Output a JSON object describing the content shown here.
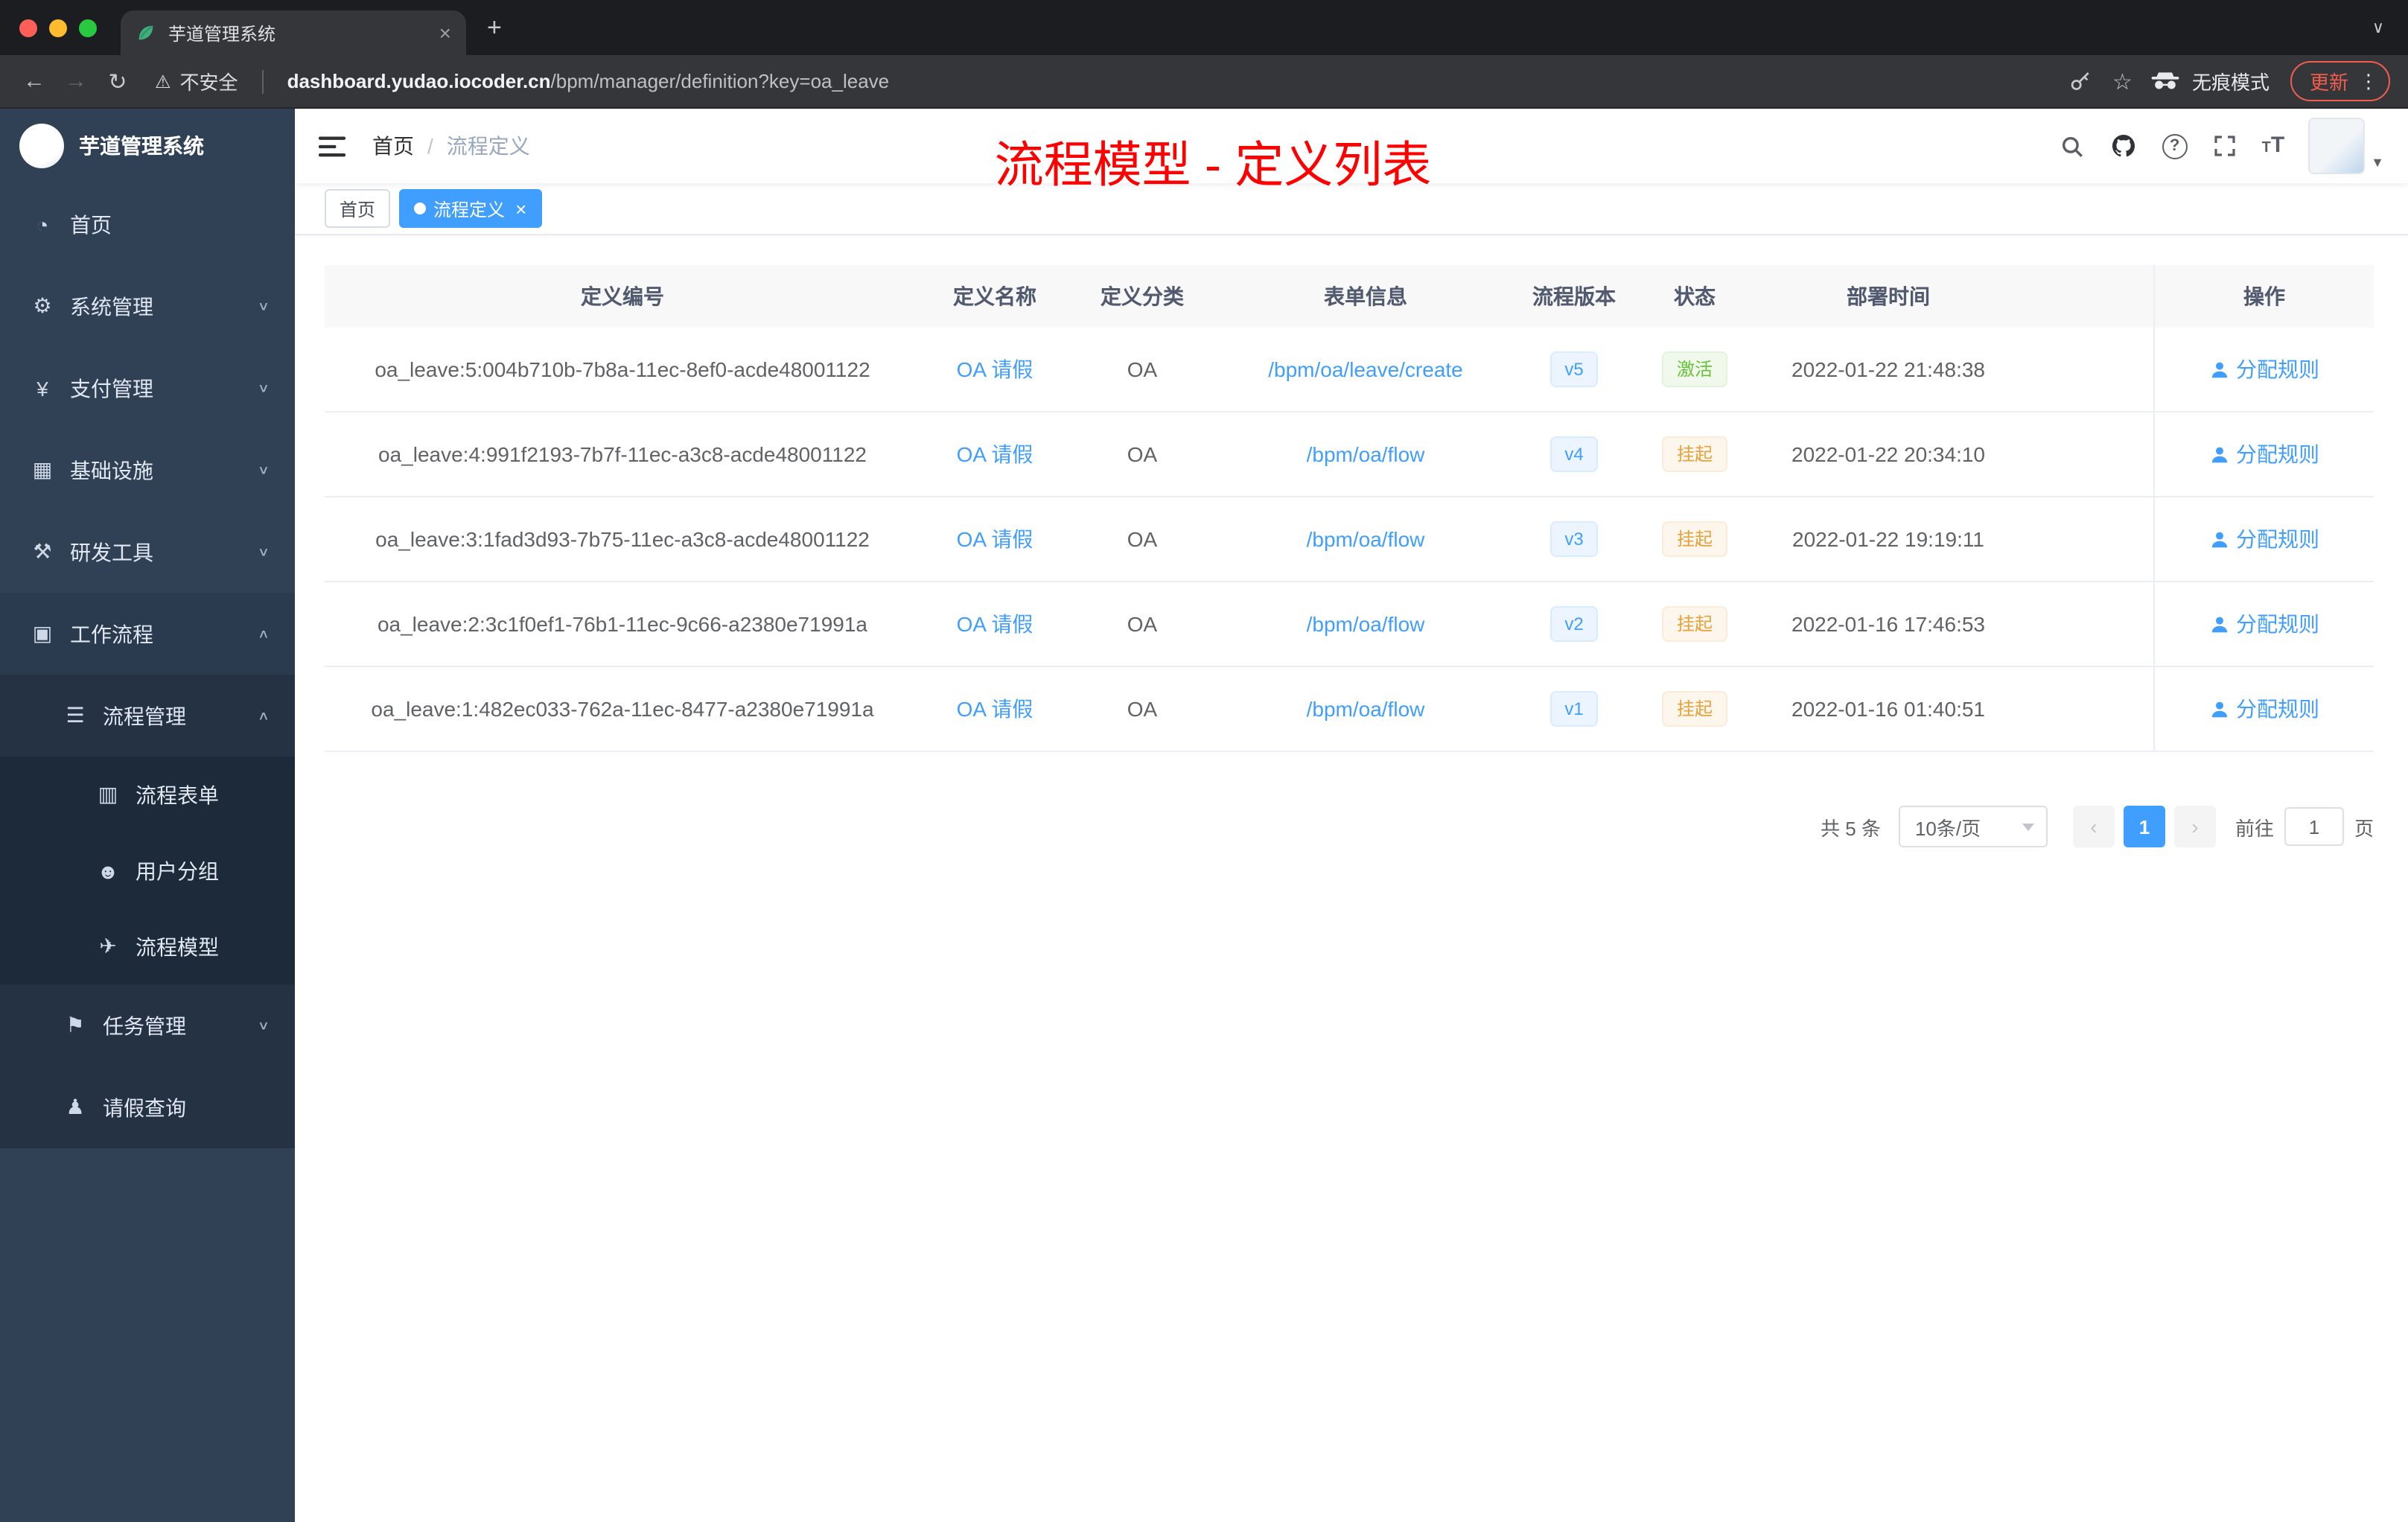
{
  "browser": {
    "tab_title": "芋道管理系统",
    "address": {
      "security_label": "不安全",
      "host": "dashboard.yudao.iocoder.cn",
      "path": "/bpm/manager/definition?key=oa_leave"
    },
    "incognito_label": "无痕模式",
    "update_label": "更新"
  },
  "sidebar": {
    "brand": "芋道管理系统",
    "items": [
      {
        "label": "首页",
        "icon": "dashboard-icon",
        "level": 1
      },
      {
        "label": "系统管理",
        "icon": "gear-icon",
        "level": 1,
        "chevron": "down"
      },
      {
        "label": "支付管理",
        "icon": "payment-icon",
        "level": 1,
        "chevron": "down"
      },
      {
        "label": "基础设施",
        "icon": "infrastructure-icon",
        "level": 1,
        "chevron": "down"
      },
      {
        "label": "研发工具",
        "icon": "devtools-icon",
        "level": 1,
        "chevron": "down"
      },
      {
        "label": "工作流程",
        "icon": "workflow-icon",
        "level": 1,
        "chevron": "up",
        "opened": true
      },
      {
        "label": "流程管理",
        "icon": "process-manage-icon",
        "level": 2,
        "chevron": "up",
        "opened": true
      },
      {
        "label": "流程表单",
        "icon": "process-form-icon",
        "level": 3
      },
      {
        "label": "用户分组",
        "icon": "user-group-icon",
        "level": 3
      },
      {
        "label": "流程模型",
        "icon": "process-model-icon",
        "level": 3
      },
      {
        "label": "任务管理",
        "icon": "task-manage-icon",
        "level": 2,
        "chevron": "down"
      },
      {
        "label": "请假查询",
        "icon": "leave-query-icon",
        "level": 2
      }
    ]
  },
  "navbar": {
    "breadcrumb": [
      {
        "label": "首页"
      },
      {
        "label": "流程定义"
      }
    ],
    "annotation": "流程模型 - 定义列表",
    "right_icons": [
      "search-icon",
      "github-icon",
      "question-icon",
      "fullscreen-icon",
      "font-size-icon"
    ]
  },
  "tags": [
    {
      "label": "首页",
      "active": false,
      "closable": false
    },
    {
      "label": "流程定义",
      "active": true,
      "closable": true
    }
  ],
  "table": {
    "columns": [
      "定义编号",
      "定义名称",
      "定义分类",
      "表单信息",
      "流程版本",
      "状态",
      "部署时间",
      "操作"
    ],
    "action_label": "分配规则",
    "rows": [
      {
        "id": "oa_leave:5:004b710b-7b8a-11ec-8ef0-acde48001122",
        "name": "OA 请假",
        "category": "OA",
        "form": "/bpm/oa/leave/create",
        "version": "v5",
        "status": "激活",
        "status_type": "success",
        "deploy_time": "2022-01-22 21:48:38"
      },
      {
        "id": "oa_leave:4:991f2193-7b7f-11ec-a3c8-acde48001122",
        "name": "OA 请假",
        "category": "OA",
        "form": "/bpm/oa/flow",
        "version": "v4",
        "status": "挂起",
        "status_type": "warning",
        "deploy_time": "2022-01-22 20:34:10"
      },
      {
        "id": "oa_leave:3:1fad3d93-7b75-11ec-a3c8-acde48001122",
        "name": "OA 请假",
        "category": "OA",
        "form": "/bpm/oa/flow",
        "version": "v3",
        "status": "挂起",
        "status_type": "warning",
        "deploy_time": "2022-01-22 19:19:11"
      },
      {
        "id": "oa_leave:2:3c1f0ef1-76b1-11ec-9c66-a2380e71991a",
        "name": "OA 请假",
        "category": "OA",
        "form": "/bpm/oa/flow",
        "version": "v2",
        "status": "挂起",
        "status_type": "warning",
        "deploy_time": "2022-01-16 17:46:53"
      },
      {
        "id": "oa_leave:1:482ec033-762a-11ec-8477-a2380e71991a",
        "name": "OA 请假",
        "category": "OA",
        "form": "/bpm/oa/flow",
        "version": "v1",
        "status": "挂起",
        "status_type": "warning",
        "deploy_time": "2022-01-16 01:40:51"
      }
    ]
  },
  "pagination": {
    "total_label": "共 5 条",
    "page_size_label": "10条/页",
    "current_page": "1",
    "goto_label": "前往",
    "goto_value": "1",
    "page_unit_label": "页"
  },
  "colors": {
    "accent": "#409eff",
    "success": "#67c23a",
    "warning": "#e6a23c",
    "annotation": "#ff0000",
    "sidebar_bg": "#304156",
    "sidebar_sub_bg": "#1f2d3d"
  }
}
